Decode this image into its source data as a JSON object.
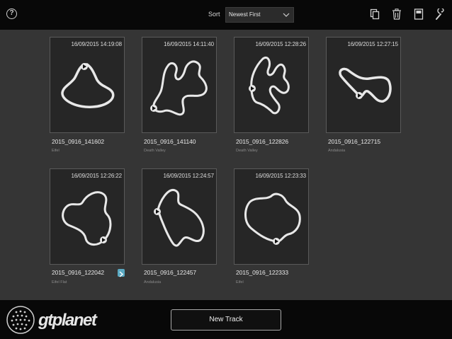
{
  "header": {
    "help_icon": "question-icon",
    "help_glyph": "?",
    "sort_label": "Sort",
    "sort_value": "Newest First",
    "tools": [
      "copy-icon",
      "trash-icon",
      "save-icon",
      "wrench-icon"
    ]
  },
  "tracks": [
    {
      "date": "16/09/2015 14:19:08",
      "name": "2015_0916_141602",
      "location": "Eifel"
    },
    {
      "date": "16/09/2015 14:11:40",
      "name": "2015_0916_141140",
      "location": "Death Valley"
    },
    {
      "date": "16/09/2015 12:28:26",
      "name": "2015_0916_122826",
      "location": "Death Valley"
    },
    {
      "date": "16/09/2015 12:27:15",
      "name": "2015_0916_122715",
      "location": "Andalusia"
    },
    {
      "date": "16/09/2015 12:26:22",
      "name": "2015_0916_122042",
      "location": "Eifel Flat"
    },
    {
      "date": "16/09/2015 12:24:57",
      "name": "2015_0916_122457",
      "location": "Andalusia"
    },
    {
      "date": "16/09/2015 12:23:33",
      "name": "2015_0916_122333",
      "location": "Eifel"
    }
  ],
  "footer": {
    "logo_text": "gtplanet",
    "new_track_label": "New Track"
  },
  "colors": {
    "share_accent": "#5aa9c2"
  }
}
